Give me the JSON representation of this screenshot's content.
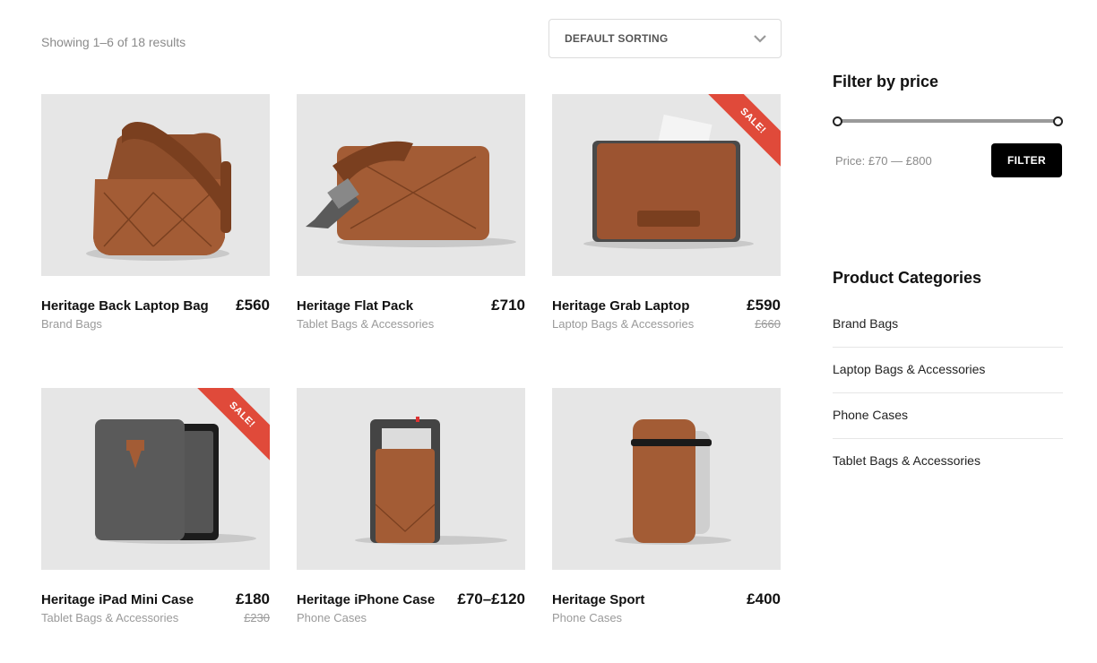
{
  "shop": {
    "result_count": "Showing 1–6 of 18 results",
    "sorting": {
      "selected": "DEFAULT SORTING",
      "icon": "chevron-down-icon"
    }
  },
  "products": [
    {
      "title": "Heritage Back Laptop Bag",
      "category": "Brand Bags",
      "price": "£560",
      "old_price": "",
      "sale": ""
    },
    {
      "title": "Heritage Flat Pack",
      "category": "Tablet Bags & Accessories",
      "price": "£710",
      "old_price": "",
      "sale": ""
    },
    {
      "title": "Heritage Grab Laptop",
      "category": "Laptop Bags & Accessories",
      "price": "£590",
      "old_price": "£660",
      "sale": "SALE!"
    },
    {
      "title": "Heritage iPad Mini Case",
      "category": "Tablet Bags & Accessories",
      "price": "£180",
      "old_price": "£230",
      "sale": "SALE!"
    },
    {
      "title": "Heritage iPhone Case",
      "category": "Phone Cases",
      "price": "£70–£120",
      "old_price": "",
      "sale": ""
    },
    {
      "title": "Heritage Sport",
      "category": "Phone Cases",
      "price": "£400",
      "old_price": "",
      "sale": ""
    }
  ],
  "sidebar": {
    "filter": {
      "title": "Filter by price",
      "price_label": "Price: £70 — £800",
      "button": "FILTER",
      "range_fraction": [
        0,
        1
      ]
    },
    "categories": {
      "title": "Product Categories",
      "items": [
        "Brand Bags",
        "Laptop Bags & Accessories",
        "Phone Cases",
        "Tablet Bags & Accessories"
      ]
    }
  },
  "colors": {
    "sale_ribbon": "#e04a3a",
    "thumb_bg": "#e6e6e6",
    "leather": "#9a5530",
    "felt": "#555555"
  }
}
